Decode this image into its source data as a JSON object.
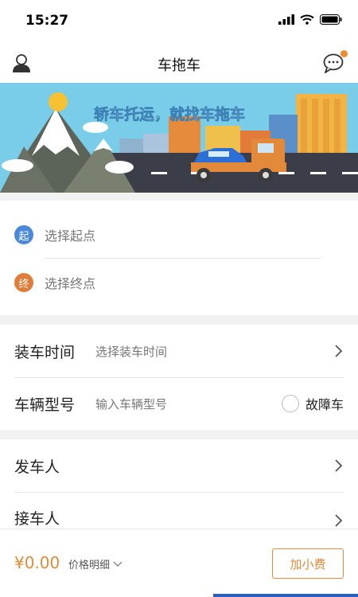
{
  "status": {
    "time": "15:27"
  },
  "nav": {
    "title": "车拖车"
  },
  "banner": {
    "slogan": "轿车托运，就找车拖车"
  },
  "address": {
    "start_badge": "起",
    "start_placeholder": "选择起点",
    "end_badge": "终",
    "end_placeholder": "选择终点"
  },
  "info": {
    "load_time_label": "装车时间",
    "load_time_placeholder": "选择装车时间",
    "vehicle_model_label": "车辆型号",
    "vehicle_model_placeholder": "输入车辆型号",
    "broken_car_label": "故障车"
  },
  "people": {
    "sender_label": "发车人",
    "receiver_label": "接车人"
  },
  "bottom": {
    "price": "¥0.00",
    "price_detail": "价格明细",
    "tip_button": "加小费"
  },
  "colors": {
    "accent": "#e08a3a",
    "start_badge": "#4a88d8",
    "end_badge": "#e07d3a"
  },
  "icons": {
    "left": "user-icon",
    "right": "chat-icon"
  }
}
